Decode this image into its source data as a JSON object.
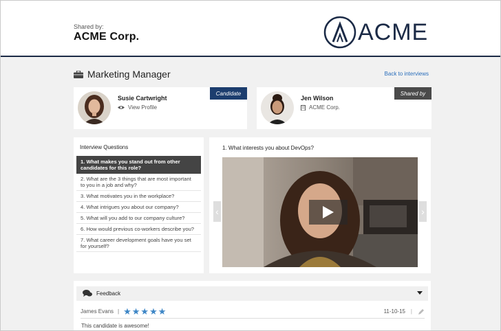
{
  "header": {
    "shared_by_label": "Shared by:",
    "company": "ACME Corp.",
    "logo_text": "ACME"
  },
  "page": {
    "title": "Marketing Manager",
    "back_link": "Back to interviews"
  },
  "candidate": {
    "name": "Susie Cartwright",
    "link": "View Profile",
    "badge": "Candidate"
  },
  "sharer": {
    "name": "Jen Wilson",
    "company": "ACME Corp.",
    "badge": "Shared by"
  },
  "questions": {
    "title": "Interview Questions",
    "items": [
      "1. What makes you stand out from other candidates for this role?",
      "2. What are the 3 things that are most important to you in a job and why?",
      "3. What motivates you in the workplace?",
      "4. What intrigues you about our company?",
      "5. What will you add to our company culture?",
      "6. How would previous co-workers describe you?",
      "7. What career development goals have you set for yourself?"
    ]
  },
  "video": {
    "question": "1. What interests you about DevOps?"
  },
  "feedback": {
    "title": "Feedback",
    "reviewer": "James Evans",
    "separator": "|",
    "rating": 5,
    "date": "11-10-15",
    "comment": "This candidate is awesome!"
  },
  "colors": {
    "navy": "#1b2a46",
    "badge_candidate": "#1c3d6e",
    "badge_shared": "#4a4a4a",
    "link": "#2a6ebb",
    "star": "#3d86c6"
  }
}
